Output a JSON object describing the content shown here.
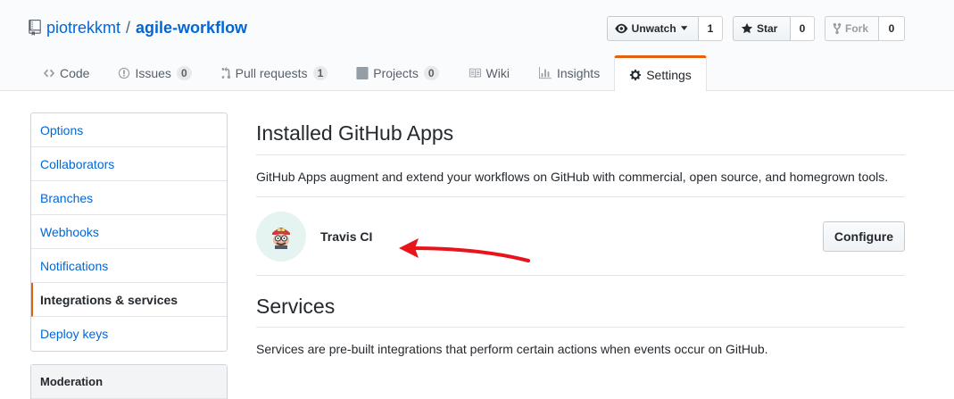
{
  "repo": {
    "owner": "piotrekkmt",
    "separator": "/",
    "name": "agile-workflow"
  },
  "actions": {
    "watch_label": "Unwatch",
    "watch_count": "1",
    "star_label": "Star",
    "star_count": "0",
    "fork_label": "Fork",
    "fork_count": "0"
  },
  "tabs": [
    {
      "label": "Code",
      "icon": "code-icon"
    },
    {
      "label": "Issues",
      "icon": "issue-icon",
      "count": "0"
    },
    {
      "label": "Pull requests",
      "icon": "pull-request-icon",
      "count": "1"
    },
    {
      "label": "Projects",
      "icon": "project-icon",
      "count": "0"
    },
    {
      "label": "Wiki",
      "icon": "book-icon"
    },
    {
      "label": "Insights",
      "icon": "graph-icon"
    },
    {
      "label": "Settings",
      "icon": "gear-icon",
      "selected": true
    }
  ],
  "sidebar": {
    "items": [
      {
        "label": "Options"
      },
      {
        "label": "Collaborators"
      },
      {
        "label": "Branches"
      },
      {
        "label": "Webhooks"
      },
      {
        "label": "Notifications"
      },
      {
        "label": "Integrations & services",
        "active": true
      },
      {
        "label": "Deploy keys"
      }
    ],
    "moderation_heading": "Moderation"
  },
  "main": {
    "apps_title": "Installed GitHub Apps",
    "apps_description": "GitHub Apps augment and extend your workflows on GitHub with commercial, open source, and homegrown tools.",
    "app": {
      "name": "Travis CI",
      "configure_label": "Configure"
    },
    "services_title": "Services",
    "services_description": "Services are pre-built integrations that perform certain actions when events occur on GitHub."
  },
  "colors": {
    "accent": "#e36209",
    "link": "#0366d6",
    "arrow": "#e8141a"
  }
}
